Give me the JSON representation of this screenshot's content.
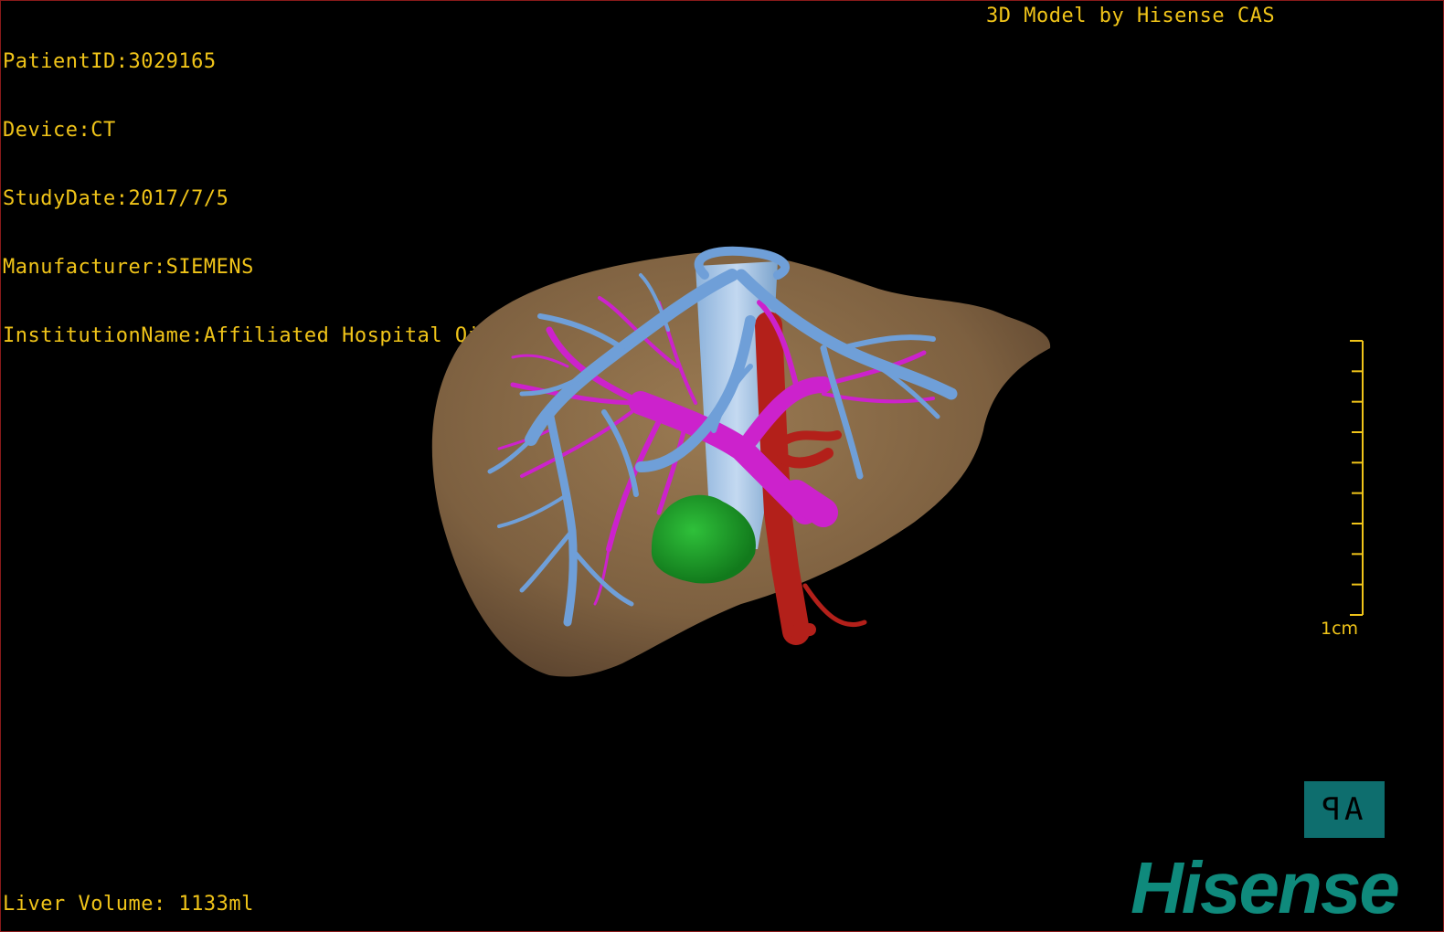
{
  "dicom_info": {
    "patient_id": "PatientID:3029165",
    "device": "Device:CT",
    "study_date": "StudyDate:2017/7/5",
    "manufacturer": "Manufacturer:SIEMENS",
    "institution": "InstitutionName:Affiliated Hospital Qingdao University-C"
  },
  "credit": "3D Model by Hisense CAS",
  "liver_volume": "Liver Volume: 1133ml",
  "scale": {
    "label": "1cm",
    "ticks": 10
  },
  "orientation_button": "ɅB",
  "orientation_left": "ꟼ",
  "orientation_right": "A",
  "brand": "Hisense",
  "colors": {
    "overlay_text": "#f0c419",
    "liver": "#8a6a45",
    "hepatic_vein": "#6f9fd8",
    "portal_vein": "#cc22cc",
    "artery": "#b3201a",
    "tumor": "#1f9a2a",
    "brand": "#0f8a7c",
    "orientation_bg": "#0e6e6e"
  }
}
